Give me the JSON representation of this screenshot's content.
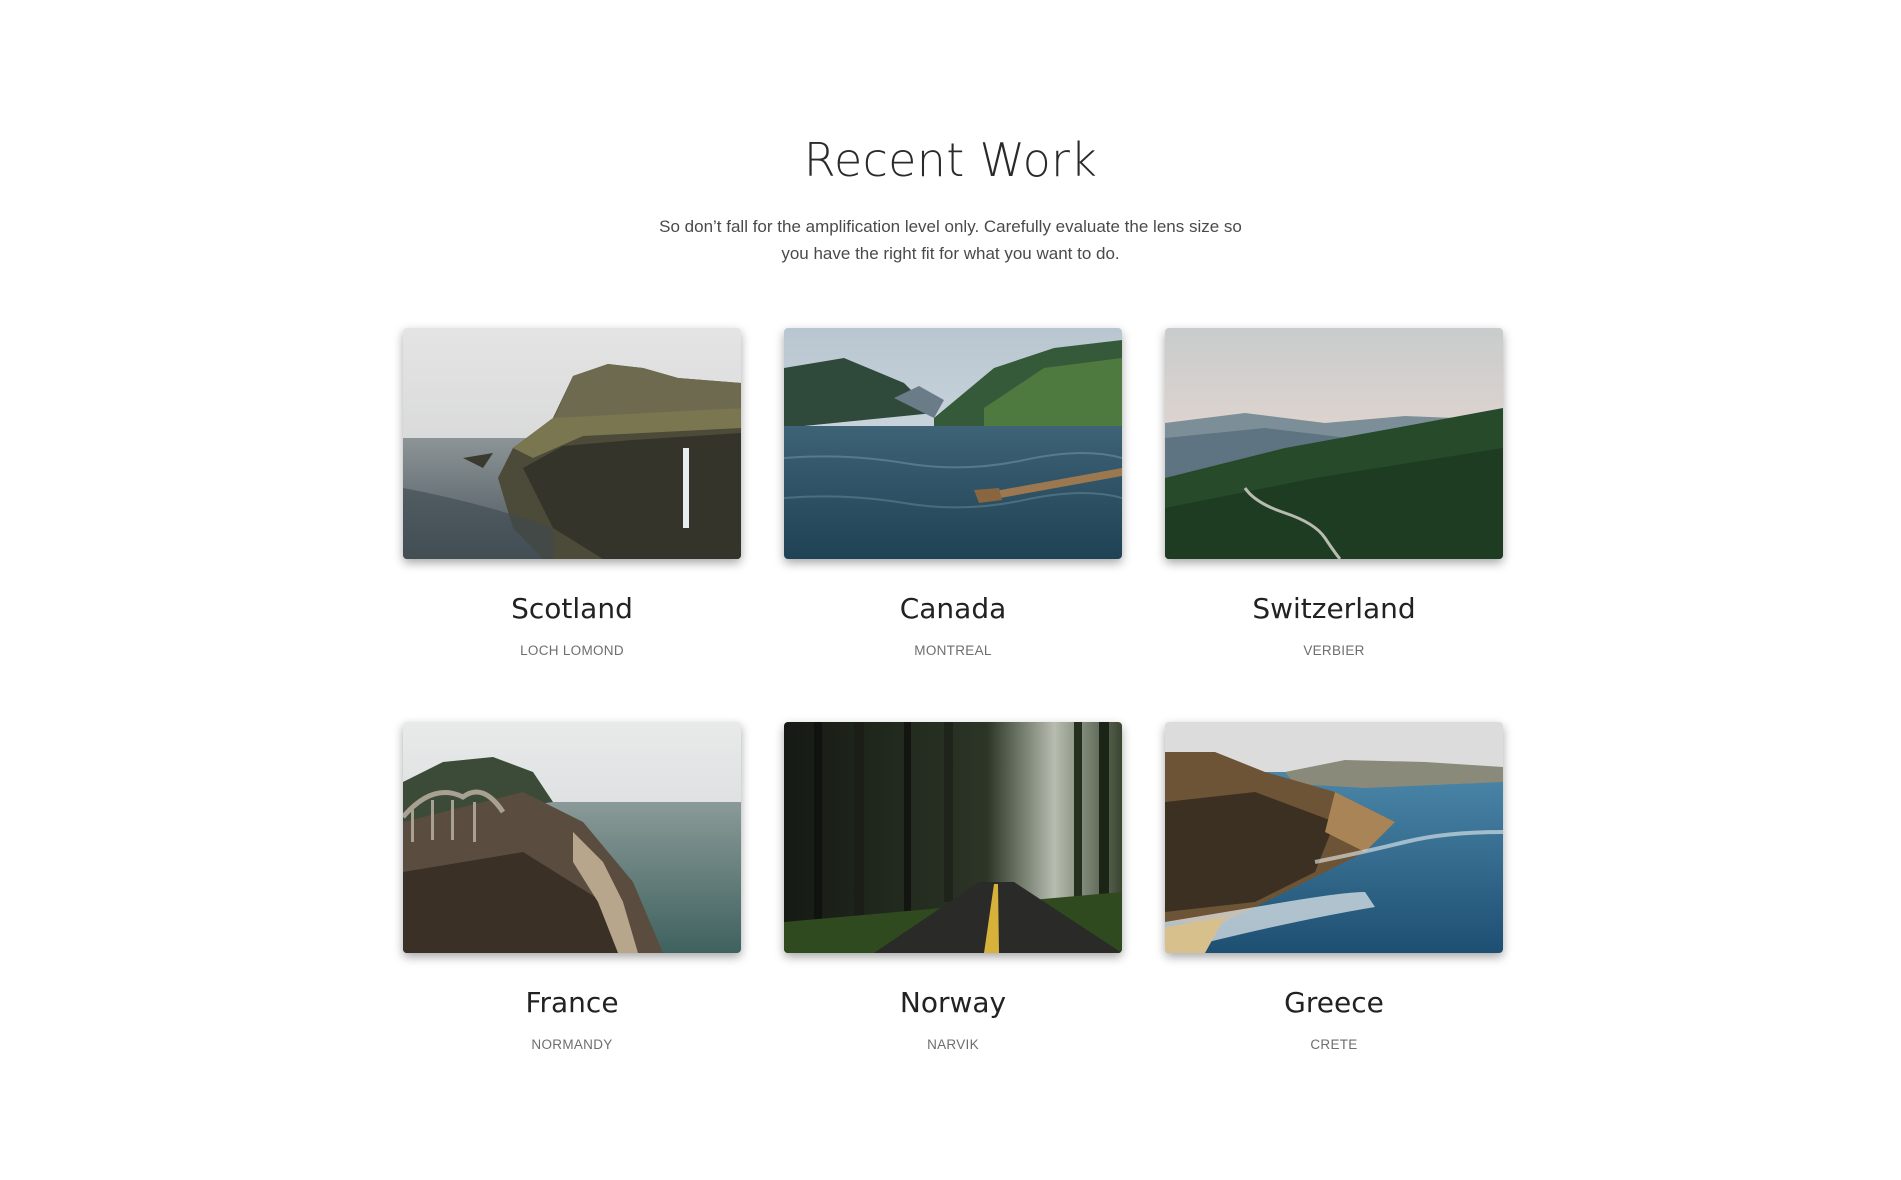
{
  "section": {
    "title": "Recent Work",
    "description": "So don’t fall for the amplification level only. Carefully evaluate the lens size so you have the right fit for what you want to do."
  },
  "projects": [
    {
      "title": "Scotland",
      "subtitle": "LOCH LOMOND",
      "image": "cliff-waterfall-image"
    },
    {
      "title": "Canada",
      "subtitle": "MONTREAL",
      "image": "lake-mountains-image"
    },
    {
      "title": "Switzerland",
      "subtitle": "VERBIER",
      "image": "forest-valley-road-image"
    },
    {
      "title": "France",
      "subtitle": "NORMANDY",
      "image": "coastal-bridge-image"
    },
    {
      "title": "Norway",
      "subtitle": "NARVIK",
      "image": "forest-road-image"
    },
    {
      "title": "Greece",
      "subtitle": "CRETE",
      "image": "sea-cliffs-image"
    }
  ]
}
